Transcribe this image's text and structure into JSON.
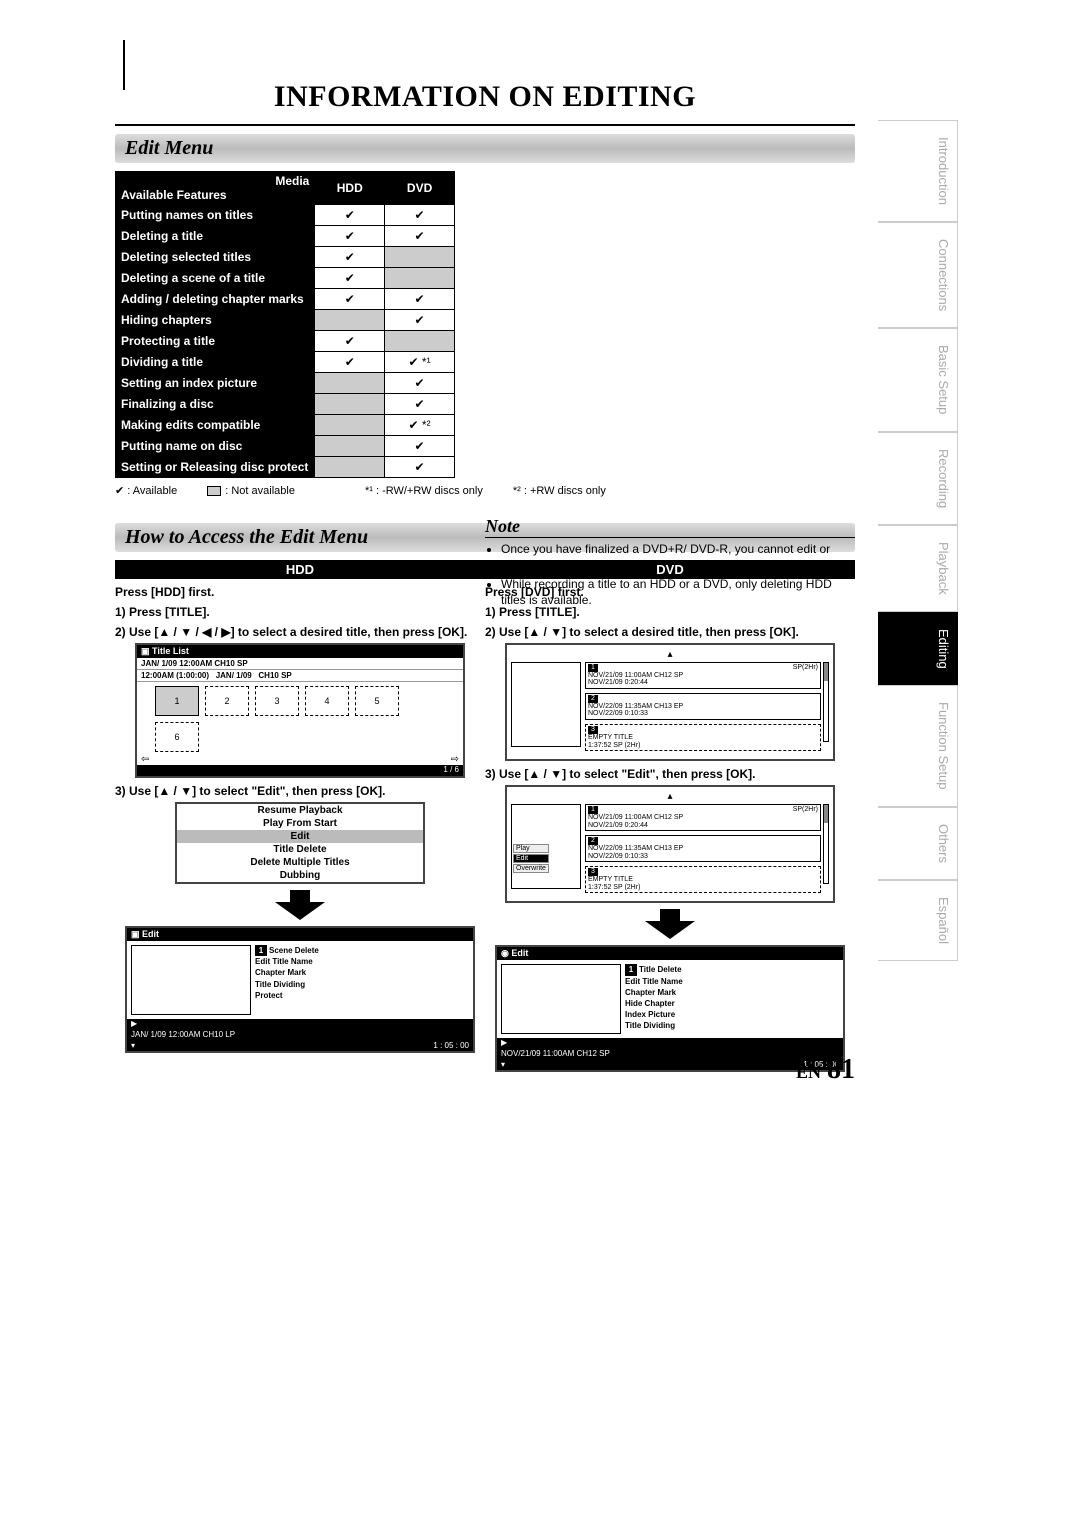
{
  "page": {
    "title": "INFORMATION ON EDITING",
    "lang_code": "EN",
    "number": "81"
  },
  "side_tabs": {
    "introduction": "Introduction",
    "connections": "Connections",
    "basic_setup": "Basic Setup",
    "recording": "Recording",
    "playback": "Playback",
    "editing": "Editing",
    "function_setup": "Function Setup",
    "others": "Others",
    "espanol": "Español"
  },
  "sections": {
    "edit_menu": "Edit Menu",
    "how_to": "How to Access the Edit Menu"
  },
  "feature_table": {
    "media_label": "Media",
    "avail_label": "Available Features",
    "col_hdd": "HDD",
    "col_dvd": "DVD",
    "rows": {
      "r0": "Putting names on titles",
      "r1": "Deleting a title",
      "r2": "Deleting selected titles",
      "r3": "Deleting a scene of a title",
      "r4": "Adding / deleting chapter marks",
      "r5": "Hiding chapters",
      "r6": "Protecting a title",
      "r7": "Dividing a title",
      "r8": "Setting an index picture",
      "r9": "Finalizing a disc",
      "r10": "Making edits compatible",
      "r11": "Putting name on disc",
      "r12": "Setting or Releasing disc protect"
    },
    "marks": {
      "check": "✔",
      "star1": "✔ *¹",
      "star2": "✔ *²"
    }
  },
  "legend": {
    "available": ": Available",
    "not_available": ": Not available",
    "fn1_label": "*¹",
    "fn1_text": ": -RW/+RW discs only",
    "fn2_label": "*²",
    "fn2_text": ": +RW discs only"
  },
  "note": {
    "heading": "Note",
    "item1": "Once you have finalized a DVD+R/ DVD-R, you cannot edit or record anything on that disc.",
    "item2": "While recording a title to an HDD or a DVD, only deleting HDD titles is available."
  },
  "howto": {
    "hdd": {
      "head": "HDD",
      "press_first": "Press [HDD] first.",
      "step1": "1) Press [TITLE].",
      "step2": "2) Use [▲ / ▼ / ◀ / ▶] to select a desired title, then press [OK].",
      "step3": "3) Use [▲ / ▼] to select \"Edit\", then press [OK]."
    },
    "dvd": {
      "head": "DVD",
      "press_first": "Press [DVD] first.",
      "step1": "1) Press [TITLE].",
      "step2": "2) Use [▲ / ▼] to select a desired title, then press [OK].",
      "step3": "3) Use [▲ / ▼] to select \"Edit\", then press [OK]."
    }
  },
  "screens": {
    "hdd_titlelist": {
      "bar": "Title List",
      "line1": "JAN/ 1/09 12:00AM CH10 SP",
      "line2a": "12:00AM (1:00:00)",
      "line2b": "JAN/ 1/09",
      "line2c": "CH10 SP",
      "t1": "1",
      "t2": "2",
      "t3": "3",
      "t4": "4",
      "t5": "5",
      "t6": "6",
      "pager": "1 / 6"
    },
    "hdd_menu": {
      "m1": "Resume Playback",
      "m2": "Play From Start",
      "m3": "Edit",
      "m4": "Title Delete",
      "m5": "Delete Multiple Titles",
      "m6": "Dubbing"
    },
    "hdd_edit": {
      "bar": "Edit",
      "num": "1",
      "o1": "Scene Delete",
      "o2": "Edit Title Name",
      "o3": "Chapter Mark",
      "o4": "Title Dividing",
      "o5": "Protect",
      "footer_l": "JAN/ 1/09 12:00AM CH10  LP",
      "footer_r": "1 : 05 : 00"
    },
    "dvd_list": {
      "mode": "SP(2Hr)",
      "i1a": "NOV/21/09  11:00AM CH12 SP",
      "i1b": "NOV/21/09   0:20:44",
      "i2a": "NOV/22/09  11:35AM CH13 EP",
      "i2b": "NOV/22/09   0:10:33",
      "i3a": "EMPTY TITLE",
      "i3b": "1:37:52  SP (2Hr)",
      "n1": "1",
      "n2": "2",
      "n3": "3"
    },
    "dvd_tabs": {
      "t1": "Play",
      "t2": "Edit",
      "t3": "Overwrite"
    },
    "dvd_edit": {
      "bar": "Edit",
      "num": "1",
      "o1": "Title Delete",
      "o2": "Edit Title Name",
      "o3": "Chapter Mark",
      "o4": "Hide Chapter",
      "o5": "Index Picture",
      "o6": "Title Dividing",
      "footer_l": "NOV/21/09 11:00AM CH12 SP",
      "footer_r": "1 : 05 : 00"
    }
  }
}
